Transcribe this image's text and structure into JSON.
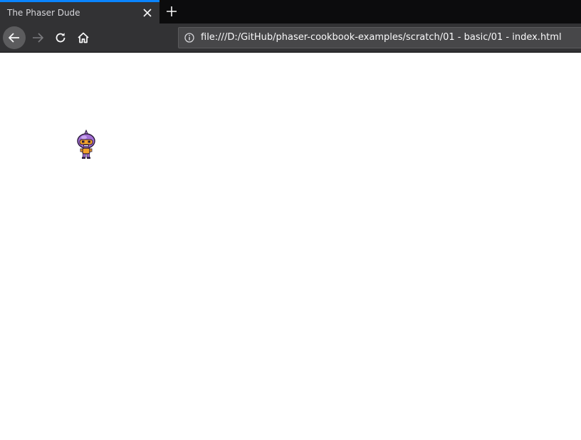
{
  "tab": {
    "title": "The Phaser Dude",
    "close_icon": "close-icon",
    "new_tab_icon": "plus-icon"
  },
  "toolbar": {
    "back_icon": "arrow-left-icon",
    "forward_icon": "arrow-right-icon",
    "reload_icon": "reload-icon",
    "home_icon": "home-icon"
  },
  "urlbar": {
    "info_icon": "info-icon",
    "url": "file:///D:/GitHub/phaser-cookbook-examples/scratch/01 - basic/01 - index.html"
  },
  "page": {
    "sprite": "phaser-dude-sprite"
  },
  "colors": {
    "tab_accent": "#0a84ff",
    "chrome_dark": "#0c0c0d",
    "chrome": "#323234",
    "sprite_purple": "#a46fd6",
    "sprite_orange": "#f2a22a"
  }
}
